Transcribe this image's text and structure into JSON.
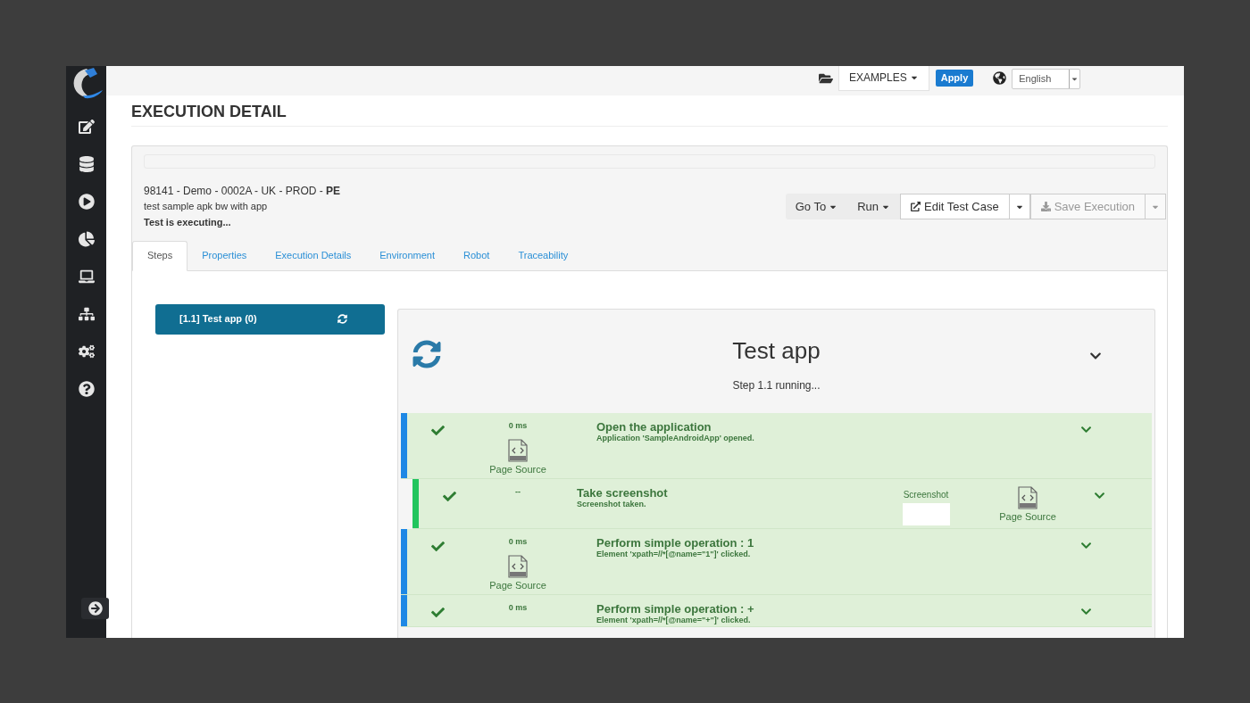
{
  "top_bar": {
    "examples": "EXAMPLES",
    "apply": "Apply",
    "language": "English"
  },
  "page_title": "EXECUTION DETAIL",
  "progress": {
    "level": 0
  },
  "execution": {
    "title": "98141 - Demo - 0002A - UK - PROD - **PE**",
    "description": "test sample apk bw with app",
    "status": "Test is executing..."
  },
  "toolbar": [
    {
      "kind": "menu",
      "label": "Go To",
      "disabled": false
    },
    {
      "kind": "menu",
      "label": "Run",
      "disabled": false
    },
    {
      "kind": "split",
      "label": "Edit Test Case",
      "disabled": false
    },
    {
      "kind": "split",
      "label": "Save Execution",
      "disabled": true
    }
  ],
  "tabs": [
    {
      "label": "Steps",
      "selected": true
    },
    {
      "label": "Properties",
      "selected": false
    },
    {
      "label": "Execution Details",
      "selected": false
    },
    {
      "label": "Environment",
      "selected": false
    },
    {
      "label": "Robot",
      "selected": false
    },
    {
      "label": "Traceability",
      "selected": false
    }
  ],
  "steps": [
    {
      "label": "[1.1] Test app (0)",
      "selected": true
    }
  ],
  "step_detail": {
    "title": "Test app",
    "status": "Step 1.1 running...",
    "actions": [
      {
        "kind": "action",
        "time": "0 ms",
        "title": "Open the application",
        "message": "Application 'SampleAndroidApp' opened.",
        "page_source": "Page Source"
      },
      {
        "kind": "control",
        "time": "--",
        "title": "Take screenshot",
        "message": "Screenshot taken.",
        "screenshot": "Screenshot",
        "page_source": "Page Source"
      },
      {
        "kind": "action",
        "time": "0 ms",
        "title": "Perform simple operation : 1",
        "message": "Element 'xpath=//*[@name=\"1\"]' clicked.",
        "page_source": "Page Source"
      },
      {
        "kind": "action",
        "time": "0 ms",
        "title": "Perform simple operation : +",
        "message": "Element 'xpath=//*[@name=\"+\"]' clicked."
      }
    ]
  }
}
